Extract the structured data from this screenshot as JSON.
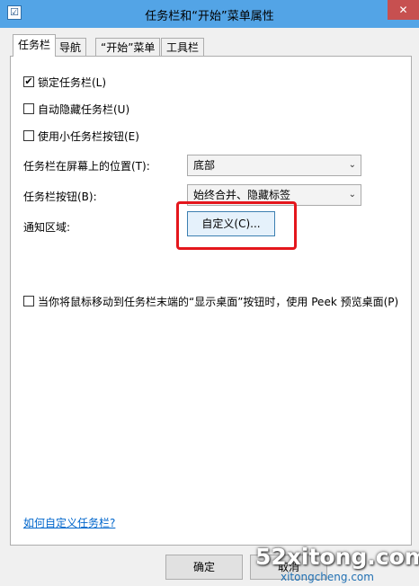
{
  "window": {
    "title": "任务栏和“开始”菜单属性",
    "close_glyph": "✕",
    "app_icon_glyph": "☑"
  },
  "tabs": [
    {
      "label": "任务栏",
      "active": true
    },
    {
      "label": "导航",
      "active": false
    },
    {
      "label": "“开始”菜单",
      "active": false
    },
    {
      "label": "工具栏",
      "active": false
    }
  ],
  "options": {
    "lock_taskbar": {
      "label": "锁定任务栏(L)",
      "checked": true
    },
    "auto_hide": {
      "label": "自动隐藏任务栏(U)",
      "checked": false
    },
    "small_buttons": {
      "label": "使用小任务栏按钮(E)",
      "checked": false
    },
    "peek": {
      "label": "当你将鼠标移动到任务栏末端的“显示桌面”按钮时，使用 Peek 预览桌面(P)",
      "checked": false
    }
  },
  "position": {
    "label": "任务栏在屏幕上的位置(T):",
    "value": "底部"
  },
  "buttons_setting": {
    "label": "任务栏按钮(B):",
    "value": "始终合并、隐藏标签"
  },
  "notification": {
    "label": "通知区域:",
    "customize_button": "自定义(C)..."
  },
  "help_link": "如何自定义任务栏?",
  "footer": {
    "ok": "确定",
    "cancel": "取消"
  },
  "watermark": {
    "main": "52xitong.com",
    "sub": "xitongcheng.com"
  },
  "check_glyph": "✔",
  "dropdown_glyph": "⌄",
  "colors": {
    "titlebar": "#53a4e6",
    "close": "#c75050",
    "highlight": "#e4161c",
    "link": "#0066cc"
  }
}
